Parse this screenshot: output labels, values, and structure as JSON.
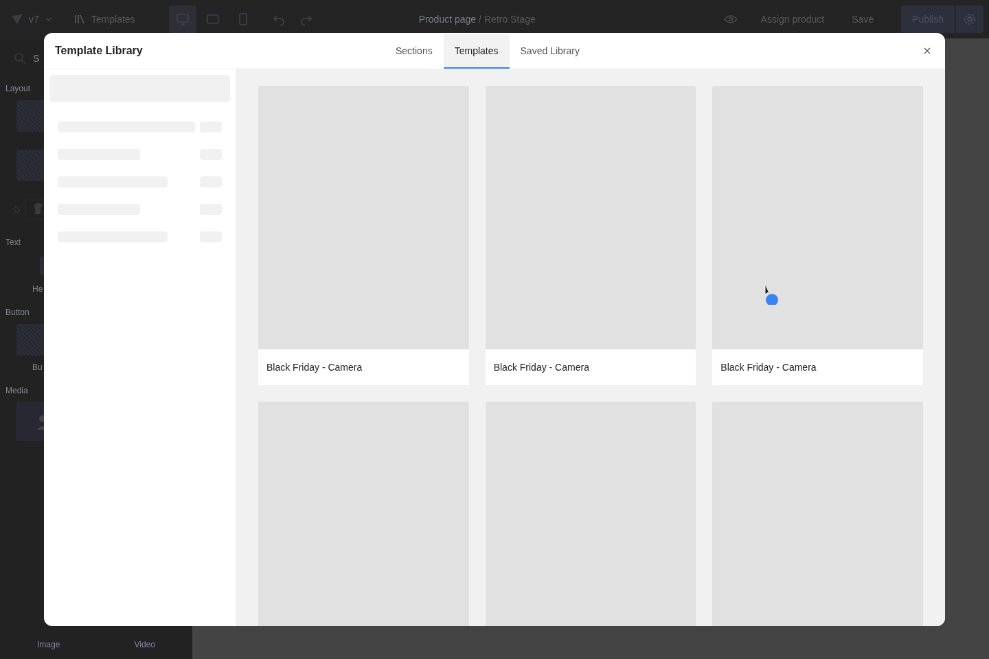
{
  "topbar": {
    "version": "v7",
    "library_label": "Templates",
    "devices": [
      {
        "kind": "desktop",
        "selected": true
      },
      {
        "kind": "tablet",
        "selected": false
      },
      {
        "kind": "mobile",
        "selected": false
      }
    ],
    "breadcrumb_parent": "Product page",
    "breadcrumb_separator": "/",
    "page_name": "Retro Stage",
    "assign_label": "Assign product",
    "save_label": "Save",
    "publish_label": "Publish"
  },
  "sidebar": {
    "search_placeholder": "S",
    "sections": [
      {
        "label": "Layout",
        "items": [
          {
            "kind": "tile"
          },
          {
            "kind": "tile"
          },
          {
            "kind": "pinned"
          }
        ]
      },
      {
        "label": "Text",
        "items": [
          {
            "kind": "glyph",
            "label": "He"
          }
        ]
      },
      {
        "label": "Button",
        "items": [
          {
            "kind": "tile",
            "label": "Bu"
          }
        ]
      },
      {
        "label": "Media",
        "items": [
          {
            "kind": "media"
          }
        ]
      }
    ],
    "bottom_labels": [
      "Image",
      "Video"
    ]
  },
  "modal": {
    "title": "Template Library",
    "tabs": [
      {
        "label": "Sections",
        "selected": false
      },
      {
        "label": "Templates",
        "selected": true
      },
      {
        "label": "Saved Library",
        "selected": false
      }
    ],
    "templates": [
      {
        "kind": "named",
        "name": "Black Friday - Camera"
      },
      {
        "kind": "named",
        "name": "Black Friday - Camera"
      },
      {
        "kind": "named",
        "name": "Black Friday - Camera"
      },
      {
        "kind": "blank"
      },
      {
        "kind": "blank"
      },
      {
        "kind": "blank"
      }
    ]
  }
}
